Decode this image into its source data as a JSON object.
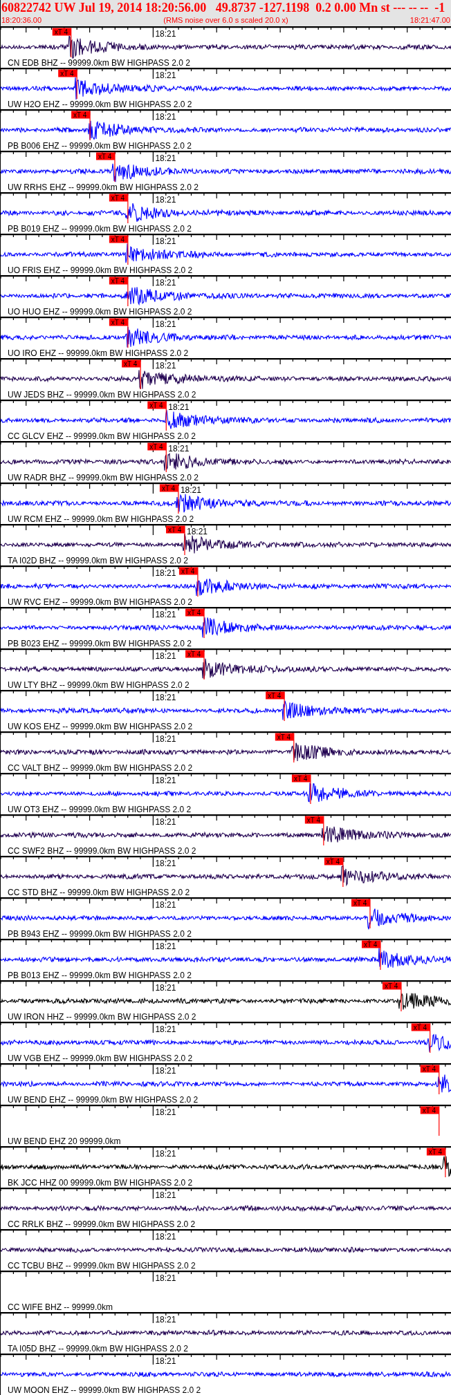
{
  "header": {
    "event": "60822742 UW Jul 19, 2014 18:20:56.00   49.8737 -127.1198  0.2 0.00 Mn st --- -- --  -1",
    "start_time": "18:20:36.00",
    "note": "(RMS noise over 6.0 s scaled 20.0 x)",
    "end_time": "18:21:47.00"
  },
  "panels": [
    {
      "kind": "trace",
      "color": "#200050",
      "time_label": "18:21",
      "station": "CN EDB BHZ -- 99999.0km BW HIGHPASS 2.0 2",
      "pick": {
        "label": "xT 4",
        "level": 0.156
      }
    },
    {
      "kind": "trace",
      "color": "#0000ff",
      "time_label": "18:21",
      "station": "UW H2O EHZ -- 99999.0km BW HIGHPASS 2.0 2",
      "pick": {
        "label": "xT 4",
        "level": 0.169
      }
    },
    {
      "kind": "trace",
      "color": "#0000ff",
      "time_label": "18:21",
      "station": "PB B006 EHZ -- 99999.0km BW HIGHPASS 2.0 2",
      "pick": {
        "label": "xT 4",
        "level": 0.198
      }
    },
    {
      "kind": "trace",
      "color": "#0000ff",
      "time_label": "18:21",
      "station": "UW RRHS EHZ -- 99999.0km BW HIGHPASS 2.0 2",
      "pick": {
        "label": "xT 4",
        "level": 0.253
      }
    },
    {
      "kind": "trace",
      "color": "#0000ff",
      "time_label": "18:21",
      "station": "PB B019 EHZ -- 99999.0km BW HIGHPASS 2.0 2",
      "pick": {
        "label": "xT 4",
        "level": 0.282
      }
    },
    {
      "kind": "trace",
      "color": "#0000ff",
      "time_label": "18:21",
      "station": "UO FRIS EHZ -- 99999.0km BW HIGHPASS 2.0 2",
      "pick": {
        "label": "xT 4",
        "level": 0.282
      }
    },
    {
      "kind": "trace",
      "color": "#0000ff",
      "time_label": "18:21",
      "station": "UO HUO EHZ -- 99999.0km BW HIGHPASS 2.0 2",
      "pick": {
        "label": "xT 4",
        "level": 0.282
      }
    },
    {
      "kind": "trace",
      "color": "#0000ff",
      "time_label": "18:21",
      "station": "UO IRO EHZ -- 99999.0km BW HIGHPASS 2.0 2",
      "pick": {
        "label": "xT 4",
        "level": 0.282
      }
    },
    {
      "kind": "trace",
      "color": "#200050",
      "time_label": "18:21",
      "station": "UW JEDS BHZ -- 99999.0km BW HIGHPASS 2.0 2",
      "pick": {
        "label": "xT 4",
        "level": 0.31
      }
    },
    {
      "kind": "trace",
      "color": "#0000ff",
      "time_label": "18:21",
      "station": "CC GLCV EHZ -- 99999.0km BW HIGHPASS 2.0 2",
      "pick": {
        "label": "xT 4",
        "level": 0.367
      }
    },
    {
      "kind": "trace",
      "color": "#200050",
      "time_label": "18:21",
      "station": "UW RADR BHZ -- 99999.0km BW HIGHPASS 2.0 2",
      "pick": {
        "label": "xT 4",
        "level": 0.367
      }
    },
    {
      "kind": "trace",
      "color": "#0000ff",
      "time_label": "18:21",
      "station": "UW RCM EHZ -- 99999.0km BW HIGHPASS 2.0 2",
      "pick": {
        "label": "xT 4",
        "level": 0.394
      }
    },
    {
      "kind": "trace",
      "color": "#200050",
      "time_label": "18:21",
      "station": "TA I02D BHZ -- 99999.0km BW HIGHPASS 2.0 2",
      "pick": {
        "label": "xT 4",
        "level": 0.408
      }
    },
    {
      "kind": "trace",
      "color": "#0000ff",
      "time_label": "18:21",
      "station": "UW RVC EHZ -- 99999.0km BW HIGHPASS 2.0 2",
      "pick": {
        "label": "xT 4",
        "level": 0.437
      }
    },
    {
      "kind": "trace",
      "color": "#0000ff",
      "time_label": "18:21",
      "station": "PB B023 EHZ -- 99999.0km BW HIGHPASS 2.0 2",
      "pick": {
        "label": "xT 4",
        "level": 0.451
      }
    },
    {
      "kind": "trace",
      "color": "#200050",
      "time_label": "18:21",
      "station": "UW LTY BHZ -- 99999.0km BW HIGHPASS 2.0 2",
      "pick": {
        "label": "xT 4",
        "level": 0.451
      }
    },
    {
      "kind": "trace",
      "color": "#0000ff",
      "time_label": "18:21",
      "station": "UW KOS EHZ -- 99999.0km BW HIGHPASS 2.0 2",
      "pick": {
        "label": "xT 4",
        "level": 0.629
      }
    },
    {
      "kind": "trace",
      "color": "#200050",
      "time_label": "18:21",
      "station": "CC VALT BHZ -- 99999.0km BW HIGHPASS 2.0 2",
      "pick": {
        "label": "xT 4",
        "level": 0.65
      }
    },
    {
      "kind": "trace",
      "color": "#0000ff",
      "time_label": "18:21",
      "station": "UW OT3 EHZ -- 99999.0km BW HIGHPASS 2.0 2",
      "pick": {
        "label": "xT 4",
        "level": 0.687
      }
    },
    {
      "kind": "trace",
      "color": "#200050",
      "time_label": "18:21",
      "station": "CC SWF2 BHZ -- 99999.0km BW HIGHPASS 2.0 2",
      "pick": {
        "label": "xT 4",
        "level": 0.716
      }
    },
    {
      "kind": "trace",
      "color": "#200050",
      "time_label": "18:21",
      "station": "CC STD BHZ -- 99999.0km BW HIGHPASS 2.0 2",
      "pick": {
        "label": "xT 4",
        "level": 0.759
      }
    },
    {
      "kind": "trace",
      "color": "#0000ff",
      "time_label": "18:21",
      "station": "PB B943 EHZ -- 99999.0km BW HIGHPASS 2.0 2",
      "pick": {
        "label": "xT 4",
        "level": 0.819
      }
    },
    {
      "kind": "trace",
      "color": "#0000ff",
      "time_label": "18:21",
      "station": "PB B013 EHZ -- 99999.0km BW HIGHPASS 2.0 2",
      "pick": {
        "label": "xT 4",
        "level": 0.842
      }
    },
    {
      "kind": "trace",
      "color": "#000000",
      "time_label": "18:21",
      "station": "UW IRON HHZ -- 99999.0km BW HIGHPASS 2.0 2",
      "pick": {
        "label": "xT 4",
        "level": 0.888
      }
    },
    {
      "kind": "trace",
      "color": "#0000ff",
      "time_label": "18:21",
      "station": "UW VGB EHZ -- 99999.0km BW HIGHPASS 2.0 2",
      "pick": {
        "label": "xT 4",
        "level": 0.952
      }
    },
    {
      "kind": "trace",
      "color": "#0000ff",
      "time_label": "18:21",
      "station": "UW BEND EHZ -- 99999.0km BW HIGHPASS 2.0 2",
      "pick": {
        "label": "xT 4",
        "level": 0.972
      }
    },
    {
      "kind": "empty",
      "time_label": "18:21",
      "station": "UW BEND EHZ 20 99999.0km",
      "pick": {
        "label": "xT 4",
        "level": 0.972
      }
    },
    {
      "kind": "trace",
      "color": "#000000",
      "time_label": "18:21",
      "station": "BK JCC HHZ 00 99999.0km BW HIGHPASS 2.0 2",
      "pick": {
        "label": "xT 4",
        "level": 0.986
      }
    },
    {
      "kind": "trace",
      "color": "#200050",
      "time_label": "18:21",
      "station": "CC RRLK BHZ -- 99999.0km BW HIGHPASS 2.0 2"
    },
    {
      "kind": "trace",
      "color": "#200050",
      "time_label": "18:21",
      "station": "CC TCBU BHZ -- 99999.0km BW HIGHPASS 2.0 2"
    },
    {
      "kind": "empty",
      "time_label": "18:21",
      "station": "CC WIFE BHZ -- 99999.0km"
    },
    {
      "kind": "trace",
      "color": "#200050",
      "time_label": "18:21",
      "station": "TA I05D BHZ -- 99999.0km BW HIGHPASS 2.0 2"
    },
    {
      "kind": "trace",
      "color": "#0000ff",
      "time_label": "18:21",
      "station": "UW MOON EHZ -- 99999.0km BW HIGHPASS 2.0 2"
    }
  ]
}
